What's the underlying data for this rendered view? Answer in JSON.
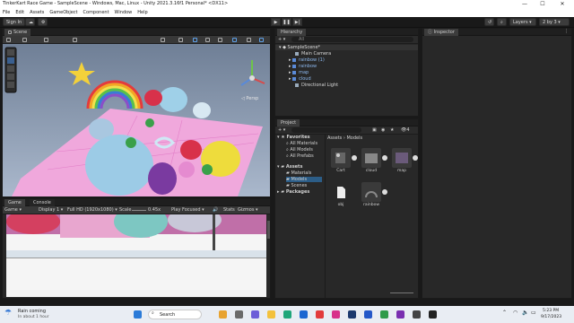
{
  "window": {
    "title": "TinkerKart Race Game - SampleScene - Windows, Mac, Linux - Unity 2021.3.16f1 Personal* <DX11>",
    "minimize": "—",
    "maximize": "☐",
    "close": "✕"
  },
  "menu": [
    "File",
    "Edit",
    "Assets",
    "GameObject",
    "Component",
    "Window",
    "Help"
  ],
  "toolbar": {
    "sign_in": "Sign In",
    "layers": "Layers",
    "layout": "2 by 3"
  },
  "scene": {
    "tab": "Scene",
    "persp": "◁ Persp"
  },
  "game": {
    "tab": "Game",
    "console_tab": "Console",
    "display_mode": "Game",
    "display": "Display 1",
    "resolution": "Full HD (1920x1080)",
    "scale_label": "Scale",
    "scale_value": "0.45x",
    "play_focused": "Play Focused",
    "stats": "Stats",
    "gizmos": "Gizmos"
  },
  "hierarchy": {
    "tab": "Hierarchy",
    "search_placeholder": "All",
    "scene_name": "SampleScene*",
    "items": [
      "Main Camera",
      "rainbow (1)",
      "rainbow",
      "map",
      "cloud",
      "Directional Light"
    ]
  },
  "inspector": {
    "tab": "Inspector"
  },
  "project": {
    "tab": "Project",
    "badge": "4",
    "favorites": "Favorites",
    "fav_items": [
      "All Materials",
      "All Models",
      "All Prefabs"
    ],
    "assets": "Assets",
    "asset_children": [
      "Materials",
      "Models",
      "Scenes"
    ],
    "packages": "Packages",
    "breadcrumb_root": "Assets",
    "breadcrumb_sep": "›",
    "breadcrumb_leaf": "Models",
    "files": [
      "Cart",
      "cloud",
      "map",
      "obj",
      "rainbow"
    ]
  },
  "taskbar": {
    "weather_title": "Rain coming",
    "weather_sub": "In about 1 hour",
    "search": "Search",
    "time": "5:23 PM",
    "date": "9/17/2023"
  },
  "colors": {
    "accent": "#3a79bb",
    "play_blue": "#2d5a8a",
    "ground_pink": "#f2a6d8",
    "sky": "#8fa3bf"
  }
}
